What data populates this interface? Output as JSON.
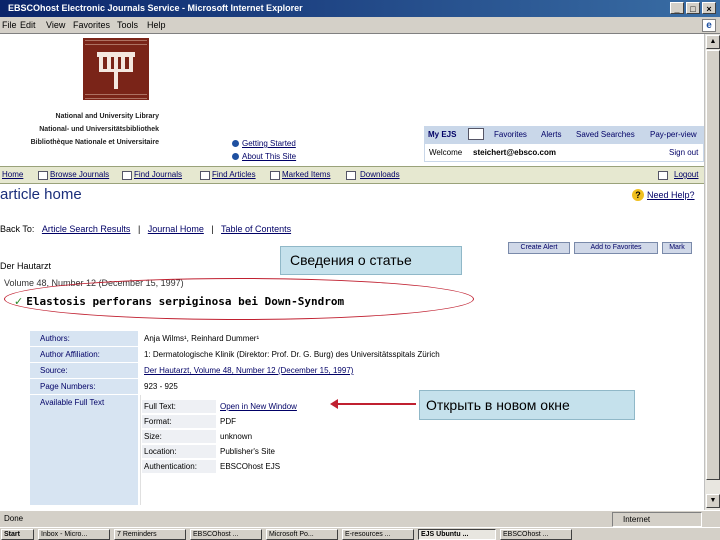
{
  "window": {
    "title": "EBSCOhost Electronic Journals Service - Microsoft Internet Explorer",
    "controls": [
      "_",
      "□",
      "×"
    ]
  },
  "menu": [
    "File",
    "Edit",
    "View",
    "Favorites",
    "Tools",
    "Help"
  ],
  "library": {
    "lines": [
      "National and University Library",
      "National- und Universitätsbibliothek",
      "Bibliothèque Nationale et Universitaire"
    ]
  },
  "help_links": [
    "Getting Started",
    "About This Site"
  ],
  "user": {
    "my_ejs": "My EJS",
    "links": [
      "Favorites",
      "Alerts",
      "Saved Searches",
      "Pay-per-view"
    ],
    "welcome_label": "Welcome",
    "email": "steichert@ebsco.com",
    "sign_out": "Sign out"
  },
  "nav": {
    "items": [
      "Home",
      "Browse Journals",
      "Find Journals",
      "Find Articles",
      "Marked Items",
      "Downloads"
    ],
    "logout": "Logout"
  },
  "page": {
    "heading": "article home",
    "help": "Need Help?",
    "back_to_label": "Back To:",
    "back_links": [
      "Article Search Results",
      "Journal Home",
      "Table of Contents"
    ],
    "separator": "|"
  },
  "actions": [
    "Create Alert",
    "Add to Favorites",
    "Mark"
  ],
  "article": {
    "journal": "Der Hautarzt",
    "volume": "Volume 48, Number 12 (December 15, 1997)",
    "check": "✓",
    "title": "Elastosis perforans serpiginosa bei Down-Syndrom"
  },
  "details": [
    {
      "label": "Authors:",
      "value": "Anja Wilms¹, Reinhard Dummer¹"
    },
    {
      "label": "Author Affiliation:",
      "value": "1: Dermatologische Klinik (Direktor: Prof. Dr. G. Burg) des Universitätsspitals Zürich"
    },
    {
      "label": "Source:",
      "value": "Der Hautarzt, Volume 48, Number 12 (December 15, 1997)"
    },
    {
      "label": "Page Numbers:",
      "value": "923 - 925"
    },
    {
      "label": "Available Full Text",
      "value": ""
    }
  ],
  "fulltext": [
    {
      "label": "Full Text:",
      "value": "Open in New Window"
    },
    {
      "label": "Format:",
      "value": "PDF"
    },
    {
      "label": "Size:",
      "value": "unknown"
    },
    {
      "label": "Location:",
      "value": "Publisher's Site"
    },
    {
      "label": "Authentication:",
      "value": "EBSCOhost EJS"
    }
  ],
  "callouts": {
    "article_info": "Сведения о статье",
    "open_new": "Открыть в новом окне"
  },
  "status": {
    "left": "Done",
    "zone": "Internet"
  },
  "taskbar": {
    "start": "Start",
    "tasks": [
      "Inbox - Micro...",
      "7 Reminders",
      "EBSCOhost ...",
      "Microsoft Po...",
      "E-resources ...",
      "EJS Ubuntu ...",
      "EBSCOhost ..."
    ]
  }
}
